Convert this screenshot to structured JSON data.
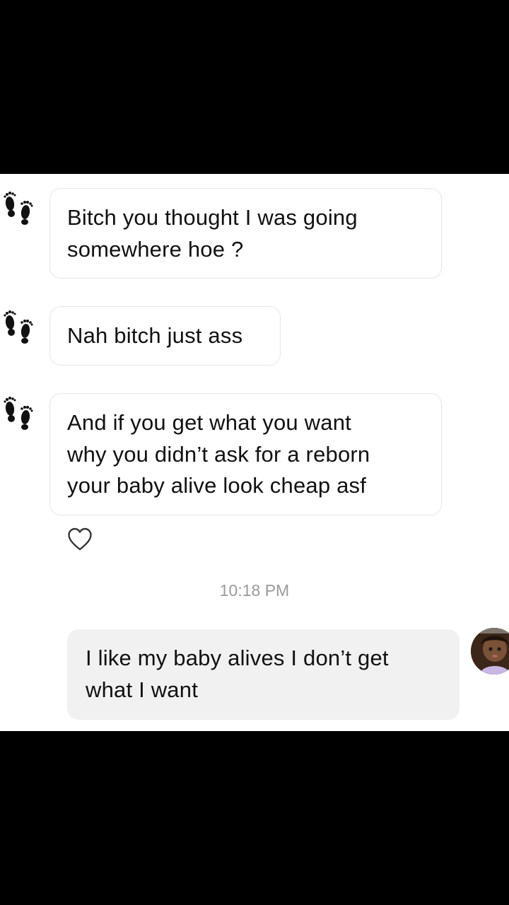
{
  "conversation": {
    "incoming_messages": [
      {
        "lines": [
          "Bitch you thought I was going",
          "somewhere hoe ?"
        ]
      },
      {
        "lines": [
          "Nah bitch just ass"
        ]
      },
      {
        "lines": [
          "And if you get what you want",
          "why you didn’t ask for a reborn",
          "your baby alive look cheap asf"
        ]
      }
    ],
    "timestamp": "10:18 PM",
    "outgoing_message": {
      "lines": [
        "I like my baby alives I don’t get",
        "what I want"
      ]
    }
  },
  "icons": {
    "sender_avatar": "footprints-icon",
    "like": "heart-outline-icon",
    "my_avatar": "doll-photo-avatar"
  },
  "colors": {
    "background": "#ffffff",
    "outgoing_bubble": "#f1f1f2",
    "incoming_bubble_border": "#e6e6e6",
    "timestamp_text": "#9a9a9a",
    "letterbox": "#000000"
  }
}
